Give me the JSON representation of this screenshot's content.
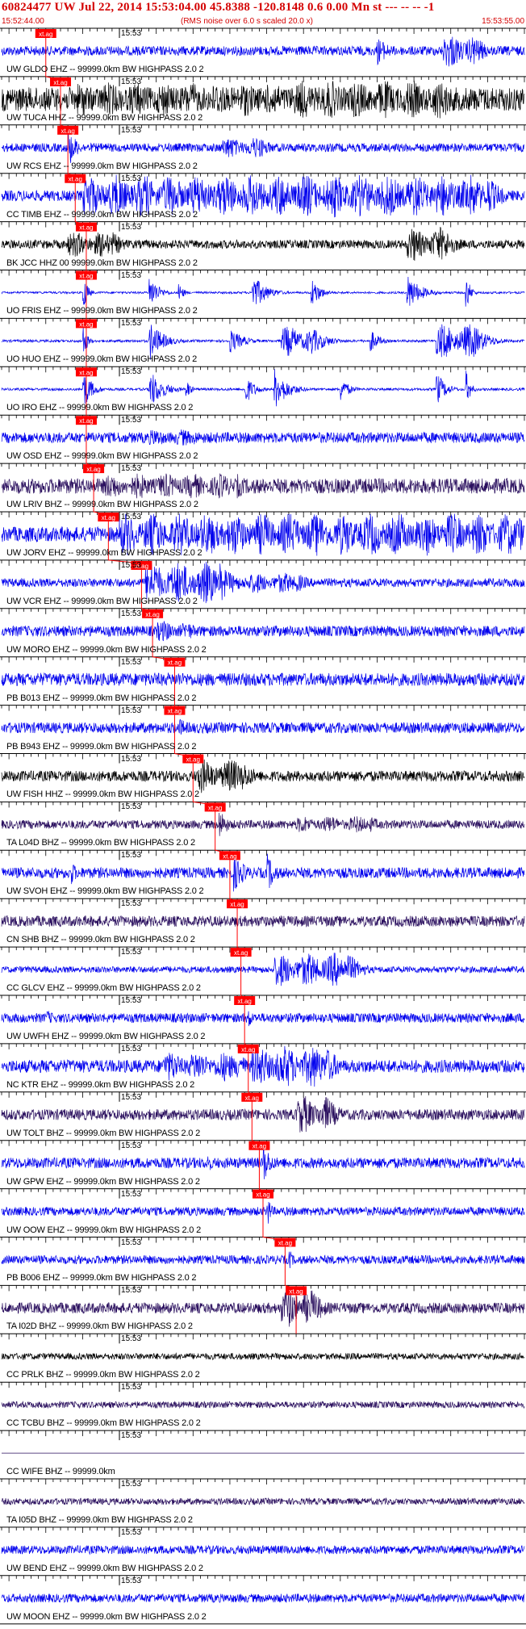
{
  "header": {
    "title": "60824477 UW Jul 22, 2014 15:53:04.00   45.8388 -120.8148  0.6 0.00 Mn st --- -- --  -1",
    "start_time": "15:52:44.00",
    "subtitle": "(RMS noise over 6.0 s scaled 20.0 x)",
    "end_time": "15:53:55.00"
  },
  "colors": {
    "header": "#d40000",
    "pick": "#ff0000",
    "trace_blue": "#0000ee",
    "trace_black": "#000000",
    "trace_purple": "#2a0f5e"
  },
  "chart_data": {
    "type": "line",
    "title": "60824477 UW Jul 22, 2014 15:53:04.00   45.8388 -120.8148  0.6 0.00 Mn st --- -- --  -1",
    "x_range": [
      "15:52:44.00",
      "15:53:55.00"
    ],
    "tick_label": "15:53",
    "pick_tag": "xt.ag",
    "series": [
      {
        "name": "UW GLDO EHZ -- 99999.0km BW  HIGHPASS  2.0  2",
        "color": "blue",
        "amp": 0.22,
        "pick_s": 6.0,
        "events": [
          [
            51,
            3,
            0.7
          ],
          [
            60,
            4,
            0.8
          ]
        ]
      },
      {
        "name": "UW TUCA HHZ -- 99999.0km BW  HIGHPASS  2.0  2",
        "color": "black",
        "amp": 0.55,
        "pick_s": 8.0,
        "events": [
          [
            10,
            30,
            0.8
          ],
          [
            40,
            20,
            0.9
          ]
        ]
      },
      {
        "name": "UW RCS EHZ -- 99999.0km BW  HIGHPASS  2.0  2",
        "color": "blue",
        "amp": 0.2,
        "pick_s": 9.0,
        "events": [
          [
            9,
            2,
            1.0
          ],
          [
            30,
            5,
            0.5
          ]
        ]
      },
      {
        "name": "CC TIMB EHZ -- 99999.0km BW  HIGHPASS  2.0  2",
        "color": "blue",
        "amp": 0.25,
        "pick_s": 10.0,
        "events": [
          [
            11,
            55,
            1.0
          ]
        ]
      },
      {
        "name": "BK JCC HHZ 00 99999.0km BW  HIGHPASS  2.0  2",
        "color": "black",
        "amp": 0.2,
        "pick_s": 11.5,
        "events": [
          [
            9,
            6,
            0.6
          ],
          [
            55,
            5,
            0.8
          ]
        ]
      },
      {
        "name": "UO FRIS EHZ -- 99999.0km BW  HIGHPASS  2.0  2",
        "color": "blue",
        "amp": 0.05,
        "pick_s": 11.5,
        "events": [
          [
            11,
            1,
            1.0
          ],
          [
            20,
            2,
            0.9
          ],
          [
            24,
            1,
            0.6
          ],
          [
            34,
            3,
            0.9
          ],
          [
            42,
            2,
            0.8
          ],
          [
            55,
            3,
            0.9
          ],
          [
            63,
            1,
            1.0
          ]
        ]
      },
      {
        "name": "UO HUO EHZ -- 99999.0km BW  HIGHPASS  2.0  2",
        "color": "blue",
        "amp": 0.06,
        "pick_s": 11.5,
        "events": [
          [
            11,
            1,
            0.9
          ],
          [
            20,
            3,
            1.0
          ],
          [
            31,
            3,
            0.6
          ],
          [
            38,
            4,
            0.7
          ],
          [
            50,
            2,
            0.6
          ],
          [
            59,
            5,
            0.8
          ]
        ]
      },
      {
        "name": "UO IRO EHZ -- 99999.0km BW  HIGHPASS  2.0  2",
        "color": "blue",
        "amp": 0.06,
        "pick_s": 11.5,
        "events": [
          [
            11,
            2,
            1.0
          ],
          [
            20,
            3,
            1.0
          ],
          [
            25,
            1,
            0.6
          ],
          [
            33,
            2,
            0.8
          ],
          [
            37,
            3,
            1.0
          ],
          [
            46,
            2,
            0.6
          ],
          [
            59,
            2,
            0.9
          ],
          [
            63,
            1,
            1.0
          ]
        ]
      },
      {
        "name": "UW OSD EHZ -- 99999.0km BW  HIGHPASS  2.0  2",
        "color": "blue",
        "amp": 0.25,
        "pick_s": 11.5,
        "events": [
          [
            20,
            6,
            0.4
          ]
        ]
      },
      {
        "name": "UW LRIV BHZ -- 99999.0km BW  HIGHPASS  2.0  2",
        "color": "purple",
        "amp": 0.35,
        "pick_s": 12.5,
        "events": [
          [
            14,
            18,
            0.6
          ]
        ]
      },
      {
        "name": "UW JORV EHZ -- 99999.0km BW  HIGHPASS  2.0  2",
        "color": "blue",
        "amp": 0.35,
        "pick_s": 14.5,
        "events": [
          [
            16,
            54,
            1.0
          ]
        ]
      },
      {
        "name": "UW VCR EHZ -- 99999.0km BW  HIGHPASS  2.0  2",
        "color": "blue",
        "amp": 0.2,
        "pick_s": 19.0,
        "events": [
          [
            19.5,
            10,
            1.0
          ],
          [
            30,
            10,
            0.5
          ]
        ]
      },
      {
        "name": "UW MORO EHZ -- 99999.0km BW  HIGHPASS  2.0  2",
        "color": "blue",
        "amp": 0.25,
        "pick_s": 20.5,
        "events": [
          [
            21,
            4,
            0.5
          ]
        ]
      },
      {
        "name": "PB B013 EHZ -- 99999.0km BW  HIGHPASS  2.0  2",
        "color": "blue",
        "amp": 0.3,
        "pick_s": 23.5,
        "events": [
          [
            24,
            2,
            0.4
          ]
        ]
      },
      {
        "name": "PB B943 EHZ -- 99999.0km BW  HIGHPASS  2.0  2",
        "color": "blue",
        "amp": 0.25,
        "pick_s": 23.5,
        "events": [
          [
            24,
            3,
            0.5
          ]
        ]
      },
      {
        "name": "UW FISH HHZ -- 99999.0km BW  HIGHPASS  2.0  2",
        "color": "black",
        "amp": 0.25,
        "pick_s": 26.0,
        "events": [
          [
            26.5,
            6,
            0.8
          ]
        ]
      },
      {
        "name": "TA L04D BHZ -- 99999.0km BW  HIGHPASS  2.0  2",
        "color": "purple",
        "amp": 0.2,
        "pick_s": 29.0,
        "events": [
          [
            29.5,
            2,
            0.8
          ],
          [
            40,
            10,
            0.4
          ]
        ]
      },
      {
        "name": "UW SVOH EHZ -- 99999.0km BW  HIGHPASS  2.0  2",
        "color": "blue",
        "amp": 0.25,
        "pick_s": 31.0,
        "events": [
          [
            9.5,
            1.5,
            0.6
          ],
          [
            31.5,
            3,
            0.9
          ],
          [
            36,
            2,
            1.0
          ]
        ]
      },
      {
        "name": "CN SHB BHZ -- 99999.0km BW  HIGHPASS  2.0  2",
        "color": "purple",
        "amp": 0.25,
        "pick_s": 32.0,
        "events": []
      },
      {
        "name": "CC GLCV EHZ -- 99999.0km BW  HIGHPASS  2.0  2",
        "color": "blue",
        "amp": 0.15,
        "pick_s": 32.5,
        "events": [
          [
            37,
            10,
            0.8
          ]
        ]
      },
      {
        "name": "UW UWFH EHZ -- 99999.0km BW  HIGHPASS  2.0  2",
        "color": "blue",
        "amp": 0.22,
        "pick_s": 33.0,
        "events": [
          [
            6,
            3,
            0.4
          ],
          [
            33.5,
            1,
            0.6
          ]
        ]
      },
      {
        "name": "NC KTR EHZ -- 99999.0km BW  HIGHPASS  2.0  2",
        "color": "blue",
        "amp": 0.3,
        "pick_s": 33.5,
        "events": [
          [
            22,
            10,
            0.7
          ],
          [
            34,
            10,
            1.0
          ]
        ]
      },
      {
        "name": "UW TOLT BHZ -- 99999.0km BW  HIGHPASS  2.0  2",
        "color": "purple",
        "amp": 0.25,
        "pick_s": 34.0,
        "events": [
          [
            40,
            4,
            0.9
          ]
        ]
      },
      {
        "name": "UW GPW EHZ -- 99999.0km BW  HIGHPASS  2.0  2",
        "color": "blue",
        "amp": 0.25,
        "pick_s": 35.0,
        "events": [
          [
            28,
            1,
            0.6
          ],
          [
            35.5,
            2,
            1.0
          ]
        ]
      },
      {
        "name": "UW OOW EHZ -- 99999.0km BW  HIGHPASS  2.0  2",
        "color": "blue",
        "amp": 0.2,
        "pick_s": 35.5,
        "events": [
          [
            36,
            1,
            0.9
          ]
        ]
      },
      {
        "name": "PB B006 EHZ -- 99999.0km BW  HIGHPASS  2.0  2",
        "color": "blue",
        "amp": 0.2,
        "pick_s": 38.5,
        "events": [
          [
            39,
            1,
            0.6
          ]
        ]
      },
      {
        "name": "TA I02D BHZ -- 99999.0km BW  HIGHPASS  2.0  2",
        "color": "purple",
        "amp": 0.25,
        "pick_s": 40.0,
        "events": [
          [
            38,
            4,
            0.9
          ],
          [
            41,
            2,
            1.0
          ]
        ]
      },
      {
        "name": "CC PRLK BHZ -- 99999.0km BW  HIGHPASS  2.0  2",
        "color": "black",
        "amp": 0.15,
        "pick_s": null,
        "events": []
      },
      {
        "name": "CC TCBU BHZ -- 99999.0km BW  HIGHPASS  2.0  2",
        "color": "purple",
        "amp": 0.15,
        "pick_s": null,
        "events": []
      },
      {
        "name": "CC WIFE BHZ -- 99999.0km",
        "color": "purple",
        "amp": 0.0,
        "pick_s": null,
        "events": []
      },
      {
        "name": "TA I05D BHZ -- 99999.0km BW  HIGHPASS  2.0  2",
        "color": "purple",
        "amp": 0.15,
        "pick_s": null,
        "events": []
      },
      {
        "name": "UW BEND EHZ -- 99999.0km BW  HIGHPASS  2.0  2",
        "color": "blue",
        "amp": 0.2,
        "pick_s": null,
        "events": []
      },
      {
        "name": "UW MOON EHZ -- 99999.0km BW  HIGHPASS  2.0  2",
        "color": "blue",
        "amp": 0.2,
        "pick_s": null,
        "events": []
      }
    ]
  }
}
